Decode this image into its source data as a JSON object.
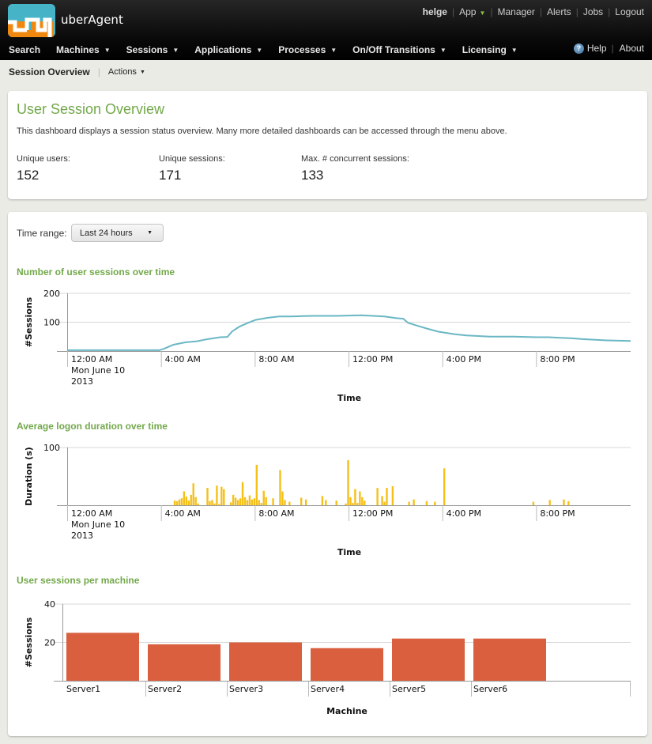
{
  "app": {
    "name": "uberAgent",
    "logo_colors": {
      "top": "#46b3c7",
      "bottom": "#f0870f"
    }
  },
  "account": {
    "user": "helge",
    "links": [
      "App",
      "Manager",
      "Alerts",
      "Jobs",
      "Logout"
    ]
  },
  "nav": {
    "items": [
      {
        "label": "Search",
        "dropdown": false
      },
      {
        "label": "Machines",
        "dropdown": true
      },
      {
        "label": "Sessions",
        "dropdown": true
      },
      {
        "label": "Applications",
        "dropdown": true
      },
      {
        "label": "Processes",
        "dropdown": true
      },
      {
        "label": "On/Off Transitions",
        "dropdown": true
      },
      {
        "label": "Licensing",
        "dropdown": true
      }
    ],
    "help": "Help",
    "about": "About"
  },
  "subbar": {
    "title": "Session Overview",
    "actions": "Actions"
  },
  "overview": {
    "title": "User Session Overview",
    "description": "This dashboard displays a session status overview. Many more detailed dashboards can be accessed through the menu above.",
    "stats": [
      {
        "label": "Unique users:",
        "value": "152"
      },
      {
        "label": "Unique sessions:",
        "value": "171"
      },
      {
        "label": "Max. # concurrent sessions:",
        "value": "133"
      }
    ]
  },
  "time_range": {
    "label": "Time range:",
    "selected": "Last 24 hours"
  },
  "colors": {
    "accent_green": "#72a84a",
    "line": "#6ab7c4",
    "logon_bars": "#f5c018",
    "machine_bars": "#d95f3e"
  },
  "chart_data": [
    {
      "type": "line",
      "title": "Number of user sessions over time",
      "xlabel": "Time",
      "ylabel": "#Sessions",
      "ylim": [
        0,
        200
      ],
      "yticks": [
        100,
        200
      ],
      "grid": true,
      "x_tick_labels": [
        {
          "hour": 0,
          "label": "12:00 AM",
          "sub": [
            "Mon June 10",
            "2013"
          ]
        },
        {
          "hour": 4,
          "label": "4:00 AM"
        },
        {
          "hour": 8,
          "label": "8:00 AM"
        },
        {
          "hour": 12,
          "label": "12:00 PM"
        },
        {
          "hour": 16,
          "label": "4:00 PM"
        },
        {
          "hour": 20,
          "label": "8:00 PM"
        }
      ],
      "x_range_hours": [
        0,
        24
      ],
      "series": [
        {
          "name": "Sessions",
          "x_hours": [
            0,
            1,
            2,
            3,
            3.9,
            4.1,
            4.5,
            5.0,
            5.5,
            6.0,
            6.5,
            6.8,
            7.0,
            7.3,
            7.6,
            8.0,
            8.5,
            9.0,
            9.5,
            10.0,
            10.5,
            11.0,
            11.5,
            12.0,
            12.5,
            13.0,
            13.5,
            14.0,
            14.3,
            14.5,
            14.8,
            15.3,
            15.8,
            16.5,
            17.0,
            17.5,
            18.0,
            18.5,
            19.0,
            19.5,
            20.0,
            20.5,
            21.0,
            21.5,
            22.0,
            22.5,
            23.0,
            23.5,
            24.0
          ],
          "values": [
            3,
            3,
            3,
            3,
            3,
            8,
            22,
            30,
            34,
            42,
            48,
            49,
            68,
            84,
            95,
            108,
            115,
            120,
            120,
            121,
            122,
            122,
            122,
            123,
            124,
            122,
            120,
            114,
            112,
            98,
            90,
            78,
            67,
            58,
            54,
            52,
            50,
            50,
            50,
            49,
            48,
            48,
            46,
            44,
            41,
            39,
            37,
            36,
            35
          ]
        }
      ]
    },
    {
      "type": "bar",
      "title": "Average logon duration over time",
      "xlabel": "Time",
      "ylabel": "Duration (s)",
      "ylim": [
        0,
        100
      ],
      "yticks": [
        100
      ],
      "grid": true,
      "x_tick_labels": [
        {
          "hour": 0,
          "label": "12:00 AM",
          "sub": [
            "Mon June 10",
            "2013"
          ]
        },
        {
          "hour": 4,
          "label": "4:00 AM"
        },
        {
          "hour": 8,
          "label": "8:00 AM"
        },
        {
          "hour": 12,
          "label": "12:00 PM"
        },
        {
          "hour": 16,
          "label": "4:00 PM"
        },
        {
          "hour": 20,
          "label": "8:00 PM"
        }
      ],
      "x_range_hours": [
        0,
        24
      ],
      "series": [
        {
          "name": "Avg logon duration",
          "x_hours": [
            4.55,
            4.65,
            4.75,
            4.85,
            4.95,
            5.05,
            5.15,
            5.25,
            5.35,
            5.45,
            5.55,
            5.95,
            6.05,
            6.15,
            6.25,
            6.35,
            6.45,
            6.55,
            6.65,
            6.95,
            7.05,
            7.15,
            7.25,
            7.35,
            7.45,
            7.55,
            7.65,
            7.75,
            7.85,
            7.95,
            8.05,
            8.15,
            8.25,
            8.35,
            8.45,
            8.75,
            9.05,
            9.15,
            9.25,
            9.45,
            9.95,
            10.15,
            10.85,
            11.0,
            11.45,
            11.85,
            11.95,
            12.05,
            12.15,
            12.25,
            12.35,
            12.45,
            12.55,
            12.65,
            13.2,
            13.4,
            13.5,
            13.6,
            13.85,
            14.55,
            14.75,
            15.3,
            15.65,
            16.05,
            19.85,
            20.55,
            21.15,
            21.35
          ],
          "values": [
            8,
            7,
            10,
            12,
            24,
            15,
            8,
            18,
            38,
            14,
            3,
            30,
            7,
            9,
            3,
            34,
            2,
            32,
            28,
            5,
            18,
            13,
            9,
            12,
            40,
            14,
            9,
            17,
            10,
            12,
            70,
            9,
            4,
            25,
            14,
            12,
            61,
            24,
            9,
            6,
            13,
            10,
            16,
            9,
            8,
            3,
            78,
            14,
            4,
            28,
            4,
            24,
            14,
            8,
            30,
            16,
            6,
            30,
            33,
            6,
            10,
            7,
            6,
            64,
            6,
            9,
            10,
            7
          ]
        }
      ]
    },
    {
      "type": "bar",
      "title": "User sessions per machine",
      "xlabel": "Machine",
      "ylabel": "#Sessions",
      "ylim": [
        0,
        40
      ],
      "yticks": [
        20,
        40
      ],
      "grid": true,
      "categories": [
        "Server1",
        "Server2",
        "Server3",
        "Server4",
        "Server5",
        "Server6"
      ],
      "values": [
        25,
        19,
        20,
        17,
        22,
        22
      ]
    }
  ]
}
